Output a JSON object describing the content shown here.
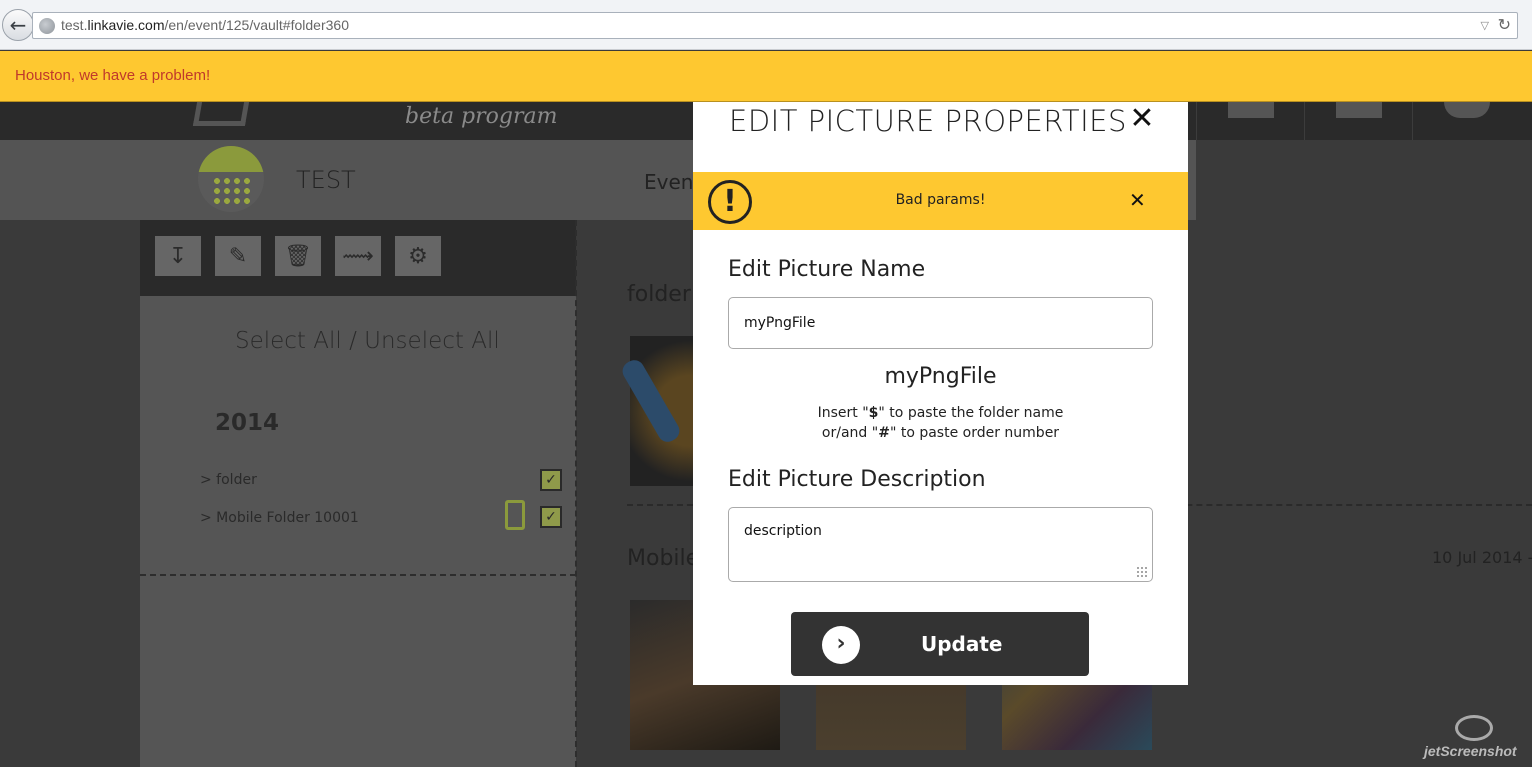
{
  "browser": {
    "url_prefix": "test.",
    "url_domain": "linkavie.com",
    "url_path": "/en/event/125/vault#folder360"
  },
  "global_alert": {
    "text": "Houston, we have a problem!"
  },
  "header": {
    "beta_label": "beta program"
  },
  "subheader": {
    "event_name": "TEST",
    "events_link": "Event"
  },
  "left_panel": {
    "select_all": "Select All / Unselect All",
    "year": "2014",
    "folders": [
      {
        "label": "> folder",
        "checked": true
      },
      {
        "label": "> Mobile Folder 10001",
        "checked": true
      }
    ]
  },
  "gallery": {
    "folder_title": "folder",
    "mobile_title": "Mobile",
    "mobile_date": "10 Jul 2014 -"
  },
  "modal": {
    "title": "EDIT PICTURE PROPERTIES",
    "close_glyph": "✕",
    "alert_text": "Bad params!",
    "alert_close_glyph": "✕",
    "name_label": "Edit Picture Name",
    "name_value": "myPngFile",
    "name_preview": "myPngFile",
    "hint_line1_pre": "Insert \"",
    "hint_line1_sym": "$",
    "hint_line1_post": "\" to paste the folder name",
    "hint_line2_pre": "or/and \"",
    "hint_line2_sym": "#",
    "hint_line2_post": "\" to paste order number",
    "description_label": "Edit Picture Description",
    "description_value": "description",
    "update_label": "Update"
  },
  "watermark": {
    "text": "jetScreenshot"
  },
  "colors": {
    "alert_yellow": "#fec830",
    "accent_green": "#8b9a3c",
    "error_red": "#c0392b"
  }
}
